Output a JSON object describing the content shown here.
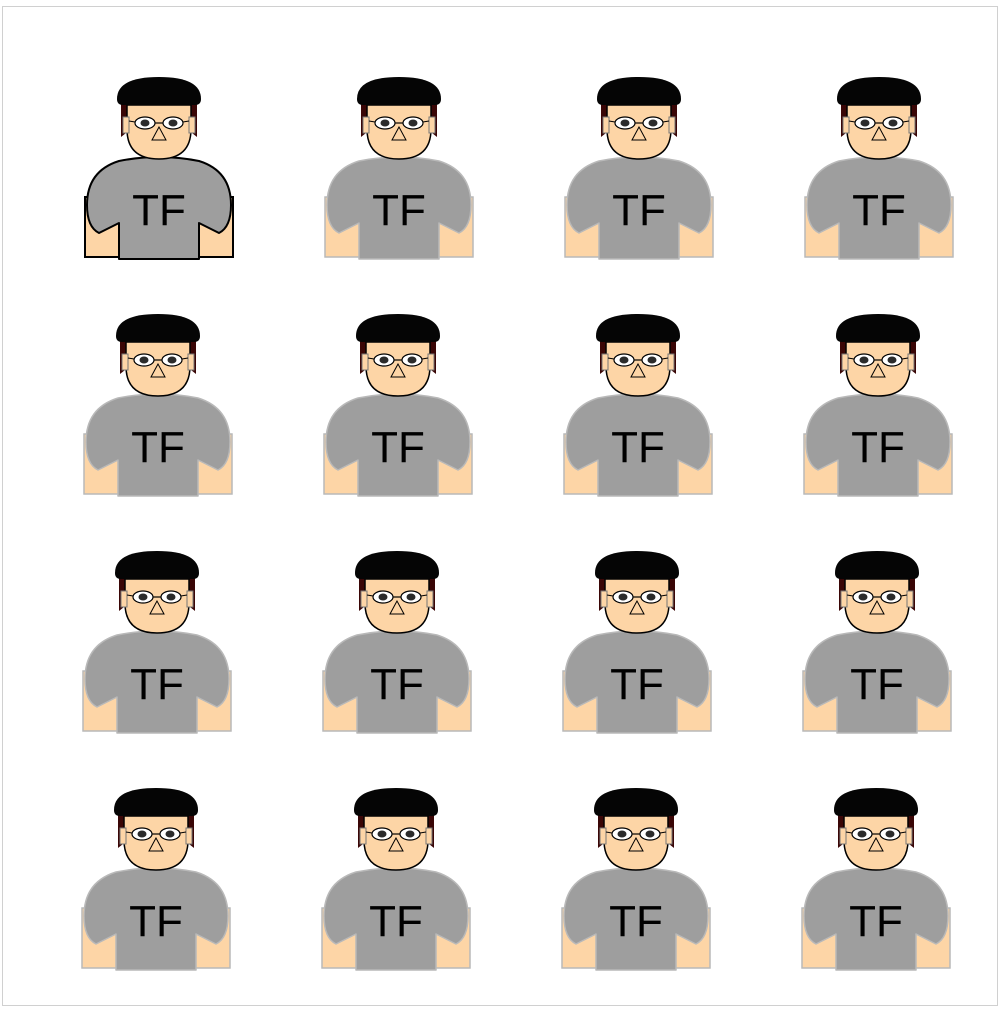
{
  "grid": {
    "rows": 4,
    "cols": 4,
    "selected_index": 0,
    "avatar": {
      "shirt_text": "TF",
      "icon": "person-avatar-icon"
    }
  },
  "colors": {
    "hair": "#050505",
    "hair_side": "#3a0606",
    "skin": "#fdd5a6",
    "shirt": "#9e9e9e",
    "shirt_text": "#000000",
    "selected_outline": "#000000",
    "unselected_outline": "#b9b9b9",
    "frame_border": "#d0d0d0"
  },
  "avatars": [
    {
      "label": "TF",
      "selected": true
    },
    {
      "label": "TF",
      "selected": false
    },
    {
      "label": "TF",
      "selected": false
    },
    {
      "label": "TF",
      "selected": false
    },
    {
      "label": "TF",
      "selected": false
    },
    {
      "label": "TF",
      "selected": false
    },
    {
      "label": "TF",
      "selected": false
    },
    {
      "label": "TF",
      "selected": false
    },
    {
      "label": "TF",
      "selected": false
    },
    {
      "label": "TF",
      "selected": false
    },
    {
      "label": "TF",
      "selected": false
    },
    {
      "label": "TF",
      "selected": false
    },
    {
      "label": "TF",
      "selected": false
    },
    {
      "label": "TF",
      "selected": false
    },
    {
      "label": "TF",
      "selected": false
    },
    {
      "label": "TF",
      "selected": false
    }
  ]
}
